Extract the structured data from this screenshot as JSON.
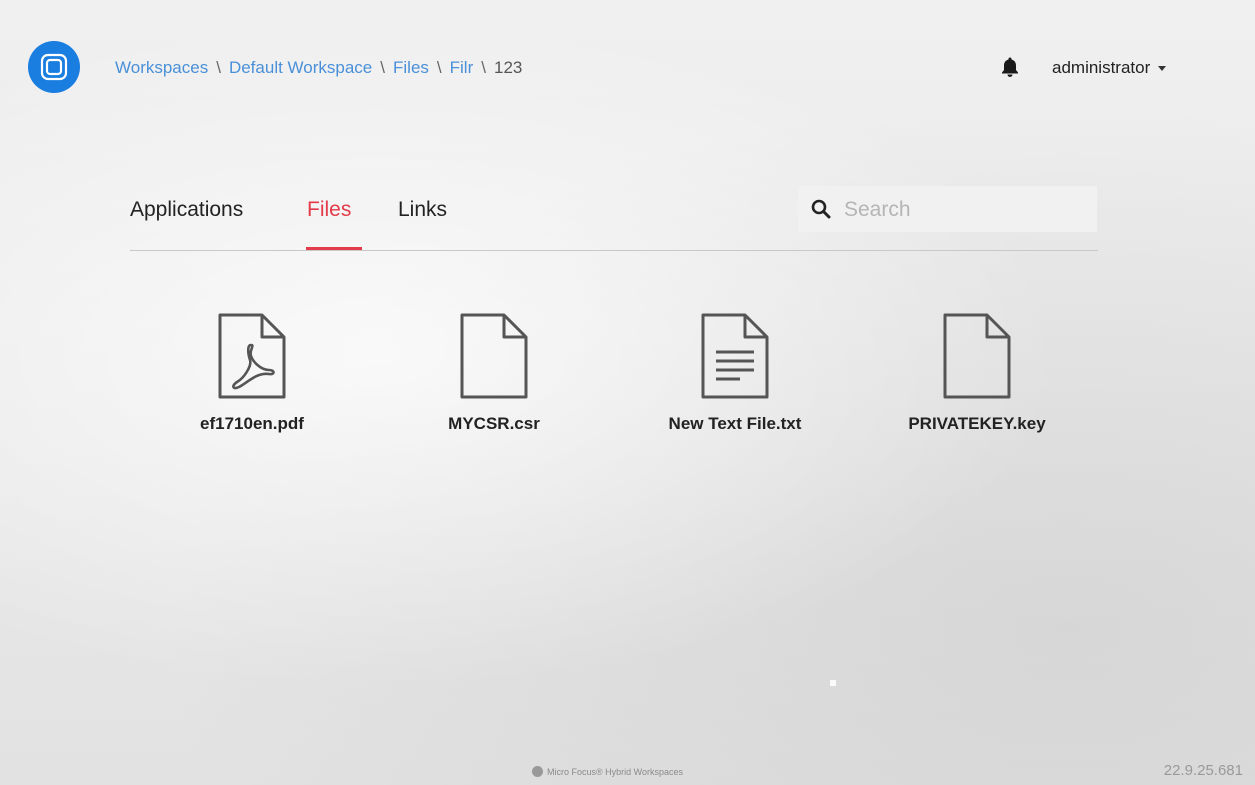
{
  "header": {
    "breadcrumb": [
      {
        "label": "Workspaces",
        "link": true
      },
      {
        "label": "Default Workspace",
        "link": true
      },
      {
        "label": "Files",
        "link": true
      },
      {
        "label": "Filr",
        "link": true
      },
      {
        "label": "123",
        "link": false
      }
    ],
    "separator": "\\",
    "user_label": "administrator"
  },
  "tabs": [
    {
      "label": "Applications",
      "active": false
    },
    {
      "label": "Files",
      "active": true
    },
    {
      "label": "Links",
      "active": false
    }
  ],
  "search": {
    "placeholder": "Search",
    "value": ""
  },
  "files": [
    {
      "name": "ef1710en.pdf",
      "icon": "pdf-file-icon"
    },
    {
      "name": "MYCSR.csr",
      "icon": "blank-file-icon"
    },
    {
      "name": "New Text File.txt",
      "icon": "text-file-icon"
    },
    {
      "name": "PRIVATEKEY.key",
      "icon": "blank-file-icon"
    }
  ],
  "footer": {
    "brand": "Micro Focus® Hybrid Workspaces",
    "version": "22.9.25.681"
  },
  "colors": {
    "accent": "#e33b4a",
    "logo": "#1a7de0",
    "link": "#4a90d9"
  }
}
